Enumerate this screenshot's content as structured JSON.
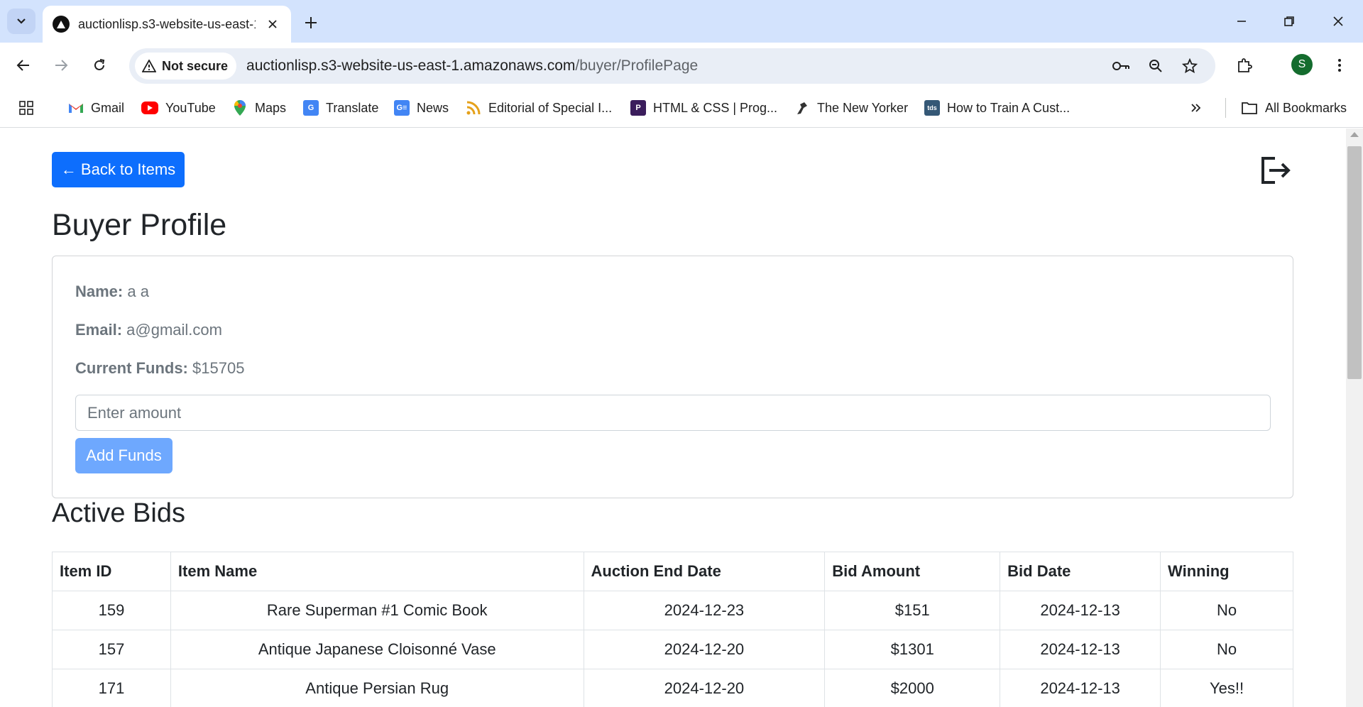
{
  "browser": {
    "tab_title": "auctionlisp.s3-website-us-east-1...",
    "security_label": "Not secure",
    "url_host": "auctionlisp.s3-website-us-east-1.amazonaws.com",
    "url_path": "/buyer/ProfilePage",
    "profile_initial": "S",
    "bookmarks": [
      {
        "label": "Gmail",
        "icon": "gmail-icon"
      },
      {
        "label": "YouTube",
        "icon": "youtube-icon"
      },
      {
        "label": "Maps",
        "icon": "maps-icon"
      },
      {
        "label": "Translate",
        "icon": "translate-icon"
      },
      {
        "label": "News",
        "icon": "news-icon"
      },
      {
        "label": "Editorial of Special I...",
        "icon": "rss-icon"
      },
      {
        "label": "HTML & CSS | Prog...",
        "icon": "p-icon"
      },
      {
        "label": "The New Yorker",
        "icon": "new-yorker-icon"
      },
      {
        "label": "How to Train A Cust...",
        "icon": "tds-icon"
      }
    ],
    "tds_icon_text": "tds",
    "all_bookmarks": "All Bookmarks"
  },
  "page": {
    "back_button": "← Back to Items",
    "profile_title": "Buyer Profile",
    "name_label": "Name:",
    "name_value": "a a",
    "email_label": "Email:",
    "email_value": "a@gmail.com",
    "funds_label": "Current Funds:",
    "funds_value": "$15705",
    "amount_placeholder": "Enter amount",
    "add_funds_button": "Add Funds",
    "bids_title": "Active Bids"
  },
  "bids_table": {
    "headers": [
      "Item ID",
      "Item Name",
      "Auction End Date",
      "Bid Amount",
      "Bid Date",
      "Winning"
    ],
    "rows": [
      [
        "159",
        "Rare Superman #1 Comic Book",
        "2024-12-23",
        "$151",
        "2024-12-13",
        "No"
      ],
      [
        "157",
        "Antique Japanese Cloisonné Vase",
        "2024-12-20",
        "$1301",
        "2024-12-13",
        "No"
      ],
      [
        "171",
        "Antique Persian Rug",
        "2024-12-20",
        "$2000",
        "2024-12-13",
        "Yes!!"
      ]
    ]
  },
  "colors": {
    "primary": "#0d6efd",
    "primary_disabled": "#6ea8fe",
    "tabstrip": "#d3e3fd"
  }
}
